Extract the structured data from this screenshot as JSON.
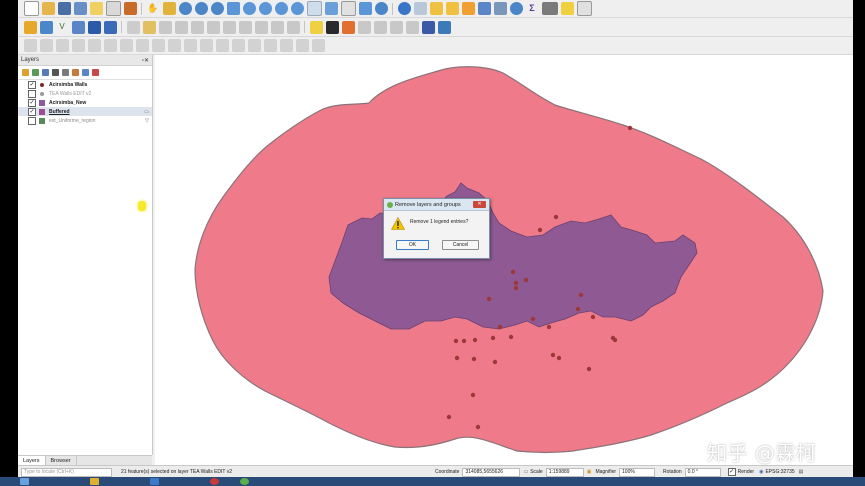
{
  "layers_panel": {
    "title": "Layers",
    "items": [
      {
        "label": "Acirsimba Walls",
        "checked": true,
        "color": "#7a2a2a",
        "bold": true
      },
      {
        "label": "TEA Walls EDIT v2",
        "checked": false,
        "color": "#9a9a9a",
        "bold": false
      },
      {
        "label": "Acirsimba_New",
        "checked": true,
        "color": "#8e5aa0",
        "bold": true
      },
      {
        "label": "Buffered",
        "checked": true,
        "color": "#9b4f8f",
        "bold": true
      },
      {
        "label": "ext_Uniforme_region",
        "checked": false,
        "color": "#5a8a5a",
        "bold": false
      }
    ]
  },
  "bottom_tabs": [
    "Layers",
    "Browser"
  ],
  "status": {
    "search_placeholder": "Type to locate (Ctrl+K)",
    "message": "21 feature(s) selected on layer TEA Walls EDIT v2",
    "coordinate_label": "Coordinate",
    "coordinate_value": "314085,5655626",
    "scale_label": "Scale",
    "scale_value": "1:159889",
    "magnifier_label": "Magnifier",
    "magnifier_value": "100%",
    "rotation_label": "Rotation",
    "rotation_value": "0.0 °",
    "render_label": "Render",
    "crs_label": "EPSG:32735"
  },
  "dialog": {
    "title": "Remove layers and groups",
    "message": "Remove 1 legend entries?",
    "ok_label": "OK",
    "cancel_label": "Cancel"
  },
  "watermark": "知乎 @霖柯",
  "colors": {
    "buffer_fill": "#ef7b8a",
    "buffer_stroke": "#8a7278",
    "region_fill": "#8f5a93",
    "point_fill": "#9b3838"
  }
}
